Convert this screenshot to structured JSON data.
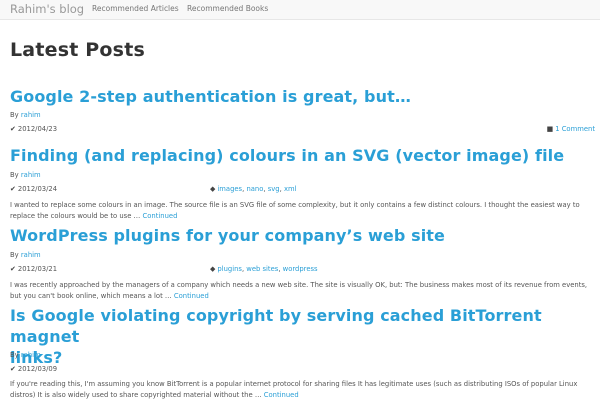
{
  "colors": {
    "accent": "#2a9fd6",
    "navbar_bg": "#f8f8f8",
    "text": "#333333"
  },
  "navbar": {
    "brand": "Rahim's blog",
    "links": [
      "Recommended Articles",
      "Recommended Books"
    ]
  },
  "page_title": "Latest Posts",
  "posts": [
    {
      "title": "Google 2-step authentication is great, but…",
      "by": "By",
      "author": "rahim",
      "date": "2012/04/23",
      "comments": "1 Comment"
    },
    {
      "title": "Finding (and replacing) colours in an SVG (vector image) file",
      "by": "By",
      "author": "rahim",
      "date": "2012/03/24",
      "tags": [
        "images",
        "nano",
        "svg",
        "xml"
      ],
      "excerpt_line1": "I wanted to replace some colours in an image.  The source file is an SVG file of some complexity, but it only contains a few distinct colours.  I thought the easiest way to",
      "excerpt_line2": "replace the colours would be to use … ",
      "continued": "Continued"
    },
    {
      "title": "WordPress plugins for your company’s web site",
      "by": "By",
      "author": "rahim",
      "date": "2012/03/21",
      "tags": [
        "plugins",
        "web sites",
        "wordpress"
      ],
      "excerpt_line1": "I was recently approached by the managers of a company which needs a new web site.  The site is visually OK, but: The business makes most of its revenue from events,",
      "excerpt_line2": "but you can't book online, which means a lot … ",
      "continued": "Continued"
    },
    {
      "title_line1": "Is Google violating copyright by serving cached BitTorrent magnet",
      "title_line2": "links?",
      "by": "By",
      "author": "rahim",
      "date": "2012/03/09",
      "excerpt_line1": "If you're reading this, I'm assuming you know BitTorrent is a popular internet protocol for sharing files It has legitimate uses (such as distributing ISOs of popular Linux",
      "excerpt_line2": "distros) It is also widely used to share copyrighted material without the … ",
      "continued": "Continued"
    }
  ]
}
